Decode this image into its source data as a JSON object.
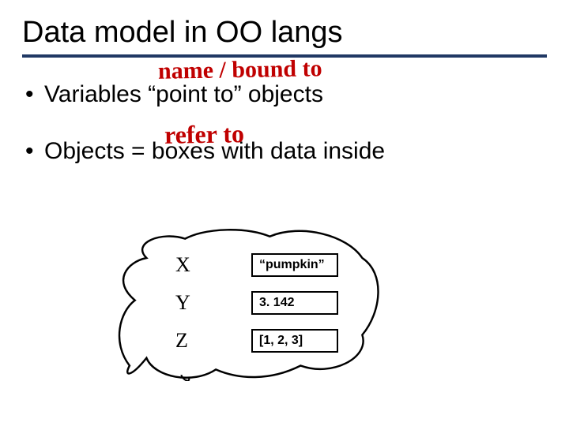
{
  "title": "Data model in OO langs",
  "bullets": {
    "b1": "Variables “point to” objects",
    "b2": "Objects = boxes with data inside"
  },
  "annotations": {
    "top": "name / bound to",
    "bottom": "refer to"
  },
  "vars": {
    "row1": {
      "name": "X",
      "value": "“pumpkin”"
    },
    "row2": {
      "name": "Y",
      "value": "3. 142"
    },
    "row3": {
      "name": "Z",
      "value": "[1, 2, 3]"
    }
  }
}
